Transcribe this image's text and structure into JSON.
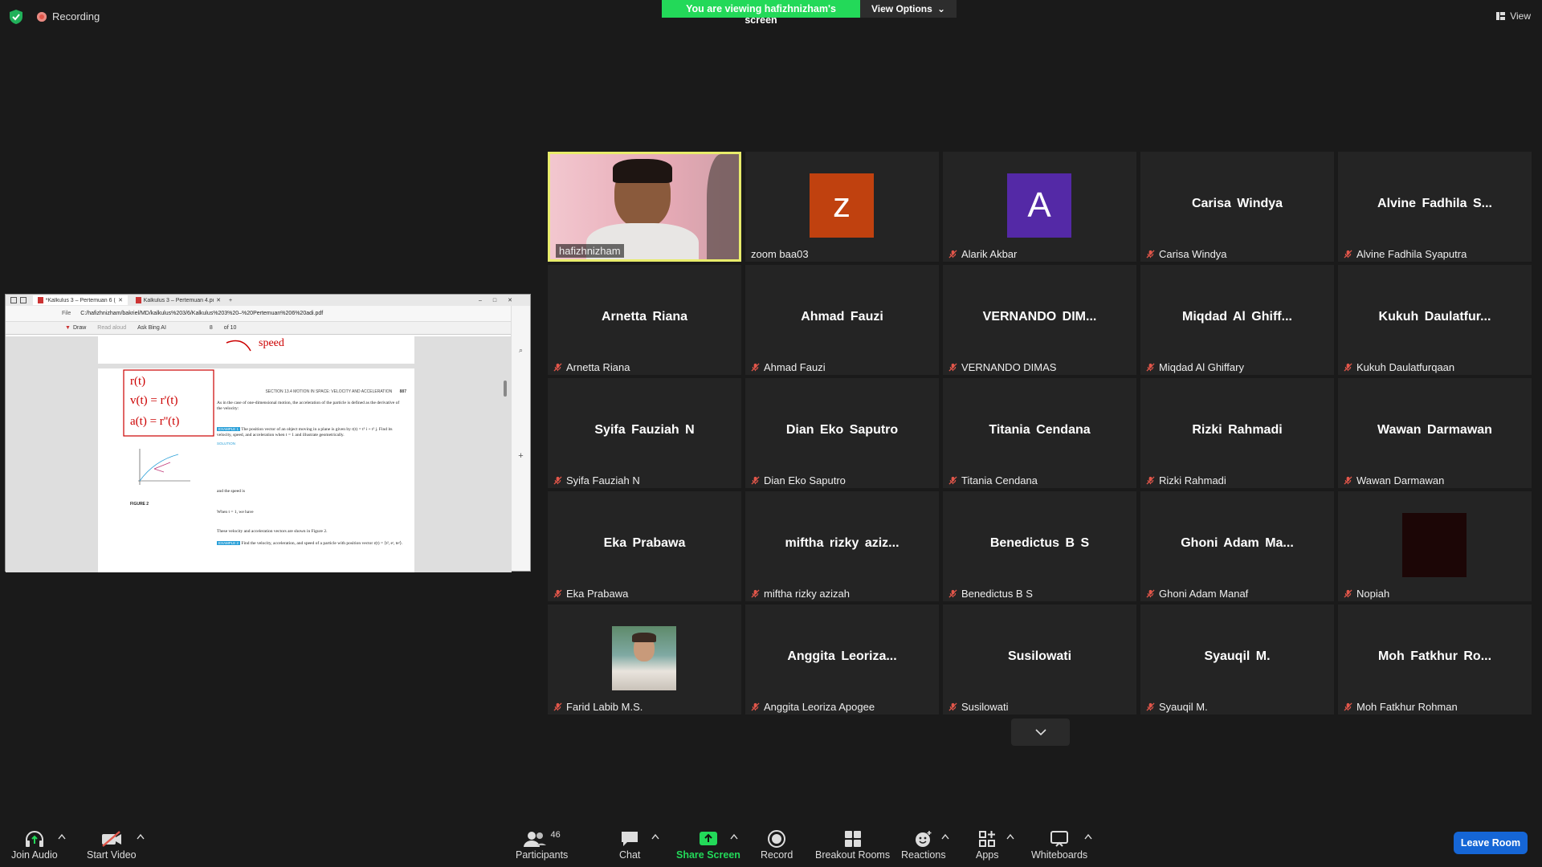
{
  "recording": "Recording",
  "viewing_banner": "You are viewing hafizhnizham's screen",
  "view_options": "View Options",
  "view_label": "View",
  "browser": {
    "tab1": "*Kalkulus 3 – Pertemuan 6 (adi)…",
    "tab2": "Kalkulus 3 – Pertemuan 4.pdf",
    "address": "C:/hafizhnizham/bakriel/MD/kalkulus%203/6/Kalkulus%203%20–%20Pertemuan%206%20adi.pdf",
    "file_label": "File",
    "draw_label": "Draw",
    "read_aloud": "Read aloud",
    "ask_ai": "Ask Bing AI",
    "page_num": "8",
    "page_total": "of 10"
  },
  "pdf": {
    "section_header": "SECTION 13.4  MOTION IN SPACE: VELOCITY AND ACCELERATION",
    "page_no": "887",
    "intro": "As in the case of one-dimensional motion, the acceleration of the particle is defined as the derivative of the velocity:",
    "example_tag": "EXAMPLE 1",
    "example_text": "The position vector of an object moving in a plane is given by r(t) = t³ i + t² j. Find its velocity, speed, and acceleration when t = 1 and illustrate geometrically.",
    "solution": "SOLUTION",
    "figure": "FIGURE 2",
    "speed_text": "and the speed is",
    "when_text": "When t = 1, we have",
    "vectors_text": "These velocity and acceleration vectors are shown in Figure 2.",
    "example2_tag": "EXAMPLE 2",
    "example2_text": "Find the velocity, acceleration, and speed of a particle with position vector r(t) = ⟨t², eᵗ, teᵗ⟩.",
    "hand_r": "r(t)",
    "hand_v": "v(t) = r'(t)",
    "hand_a": "a(t) = r''(t)",
    "hand_speed": "speed"
  },
  "tiles": [
    {
      "name": "hafizhnizham",
      "type": "video",
      "muted": false
    },
    {
      "name": "zoom baa03",
      "type": "avatar",
      "letter": "z",
      "color": "#c0410f",
      "muted": false
    },
    {
      "name": "Alarik Akbar",
      "type": "avatar",
      "letter": "A",
      "color": "#5429a6",
      "muted": true
    },
    {
      "name": "Carisa Windya",
      "center": "Carisa Windya",
      "muted": true
    },
    {
      "name": "Alvine Fadhila Syaputra",
      "center": "Alvine Fadhila S...",
      "muted": true
    },
    {
      "name": "Arnetta Riana",
      "center": "Arnetta Riana",
      "muted": true
    },
    {
      "name": "Ahmad Fauzi",
      "center": "Ahmad Fauzi",
      "muted": true
    },
    {
      "name": "VERNANDO DIMAS",
      "center": "VERNANDO DIM...",
      "muted": true
    },
    {
      "name": "Miqdad Al Ghiffary",
      "center": "Miqdad Al Ghiff...",
      "muted": true
    },
    {
      "name": "Kukuh Daulatfurqaan",
      "center": "Kukuh Daulatfur...",
      "muted": true
    },
    {
      "name": "Syifa Fauziah N",
      "center": "Syifa Fauziah N",
      "muted": true
    },
    {
      "name": "Dian Eko Saputro",
      "center": "Dian Eko Saputro",
      "muted": true
    },
    {
      "name": "Titania Cendana",
      "center": "Titania Cendana",
      "muted": true
    },
    {
      "name": "Rizki Rahmadi",
      "center": "Rizki Rahmadi",
      "muted": true
    },
    {
      "name": "Wawan Darmawan",
      "center": "Wawan Darmawan",
      "muted": true
    },
    {
      "name": "Eka Prabawa",
      "center": "Eka Prabawa",
      "muted": true
    },
    {
      "name": "miftha rizky azizah",
      "center": "miftha rizky aziz...",
      "muted": true
    },
    {
      "name": "Benedictus B S",
      "center": "Benedictus B S",
      "muted": true
    },
    {
      "name": "Ghoni Adam Manaf",
      "center": "Ghoni Adam Ma...",
      "muted": true
    },
    {
      "name": "Nopiah",
      "type": "dark",
      "muted": true
    },
    {
      "name": "Farid Labib M.S.",
      "type": "photo",
      "muted": true
    },
    {
      "name": "Anggita Leoriza Apogee",
      "center": "Anggita Leoriza...",
      "muted": true
    },
    {
      "name": "Susilowati",
      "center": "Susilowati",
      "muted": true
    },
    {
      "name": "Syauqil M.",
      "center": "Syauqil M.",
      "muted": true
    },
    {
      "name": "Moh Fatkhur Rohman",
      "center": "Moh Fatkhur Ro...",
      "muted": true
    }
  ],
  "toolbar": {
    "join_audio": "Join Audio",
    "start_video": "Start Video",
    "participants": "Participants",
    "participants_count": "46",
    "chat": "Chat",
    "share_screen": "Share Screen",
    "record": "Record",
    "breakout_rooms": "Breakout Rooms",
    "reactions": "Reactions",
    "apps": "Apps",
    "whiteboards": "Whiteboards",
    "leave_room": "Leave Room"
  },
  "colors": {
    "accent_green": "#23d959",
    "leave_blue": "#1566d6",
    "active_border": "#e8ec6b"
  }
}
